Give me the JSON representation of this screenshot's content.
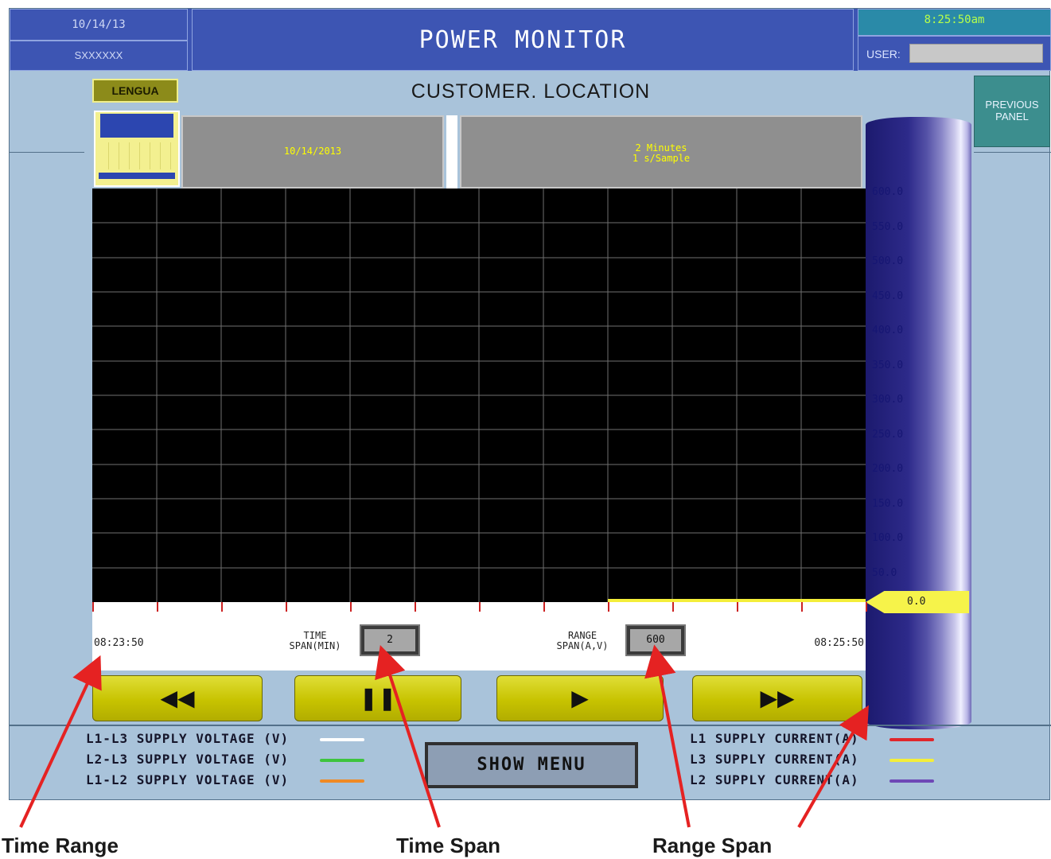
{
  "header": {
    "date": "10/14/13",
    "serial": "SXXXXXX",
    "title": "POWER MONITOR",
    "clock": "8:25:50am",
    "user_label": "USER:"
  },
  "top": {
    "lengua": "LENGUA",
    "location": "CUSTOMER. LOCATION",
    "previous_line1": "PREVIOUS",
    "previous_line2": "PANEL"
  },
  "display": {
    "date": "10/14/2013",
    "span_line1": "2 Minutes",
    "span_line2": "1 s/Sample"
  },
  "scale": {
    "labels": [
      "600.0",
      "550.0",
      "500.0",
      "450.0",
      "400.0",
      "350.0",
      "300.0",
      "250.0",
      "200.0",
      "150.0",
      "100.0",
      "50.0"
    ],
    "zero": "0.0"
  },
  "strip": {
    "start": "08:23:50",
    "end": "08:25:50",
    "time_span_line1": "TIME",
    "time_span_line2": "SPAN(MIN)",
    "time_span_value": "2",
    "range_span_line1": "RANGE",
    "range_span_line2": "SPAN(A,V)",
    "range_span_value": "600"
  },
  "controls": {
    "rewind": "◀◀",
    "pause": "❚❚",
    "play": "▶",
    "fast_forward": "▶▶"
  },
  "legend": {
    "left": [
      {
        "label": "L1-L3 SUPPLY VOLTAGE (V)",
        "color": "#ffffff"
      },
      {
        "label": "L2-L3 SUPPLY VOLTAGE (V)",
        "color": "#3ec43e"
      },
      {
        "label": "L1-L2 SUPPLY VOLTAGE (V)",
        "color": "#f08a24"
      }
    ],
    "right": [
      {
        "label": "L1 SUPPLY CURRENT(A)",
        "color": "#e0262a"
      },
      {
        "label": "L3 SUPPLY CURRENT(A)",
        "color": "#f4ee3a"
      },
      {
        "label": "L2 SUPPLY CURRENT(A)",
        "color": "#6e48b6"
      }
    ],
    "show_menu": "SHOW MENU"
  },
  "captions": {
    "time_range": "Time Range",
    "time_span": "Time Span",
    "range_span": "Range Span"
  },
  "colors": {
    "header_blue": "#3d55b3",
    "panel_bg": "#a9c3da",
    "button_yellow": "#c7c300",
    "annotation_arrow": "#e52222"
  }
}
